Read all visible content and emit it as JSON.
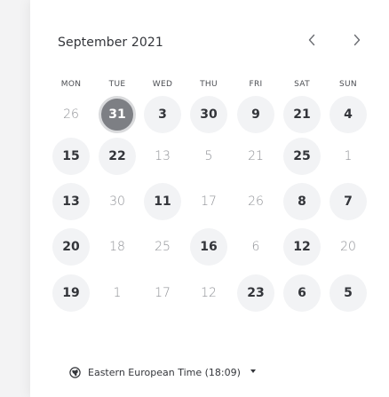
{
  "calendar": {
    "month_label": "September 2021",
    "nav": {
      "prev_icon": "chevron-left-icon",
      "next_icon": "chevron-right-icon"
    },
    "weekdays": [
      "MON",
      "TUE",
      "WED",
      "THU",
      "FRI",
      "SAT",
      "SUN"
    ],
    "weeks": [
      [
        {
          "label": "26",
          "state": "out"
        },
        {
          "label": "31",
          "state": "selected"
        },
        {
          "label": "3",
          "state": "in"
        },
        {
          "label": "30",
          "state": "in"
        },
        {
          "label": "9",
          "state": "in"
        },
        {
          "label": "21",
          "state": "in"
        },
        {
          "label": "4",
          "state": "in"
        }
      ],
      [
        {
          "label": "15",
          "state": "in"
        },
        {
          "label": "22",
          "state": "in"
        },
        {
          "label": "13",
          "state": "out"
        },
        {
          "label": "5",
          "state": "out"
        },
        {
          "label": "21",
          "state": "out"
        },
        {
          "label": "25",
          "state": "in"
        },
        {
          "label": "1",
          "state": "out"
        }
      ],
      [
        {
          "label": "13",
          "state": "in"
        },
        {
          "label": "30",
          "state": "out"
        },
        {
          "label": "11",
          "state": "in"
        },
        {
          "label": "17",
          "state": "out"
        },
        {
          "label": "26",
          "state": "out"
        },
        {
          "label": "8",
          "state": "in"
        },
        {
          "label": "7",
          "state": "in"
        }
      ],
      [
        {
          "label": "20",
          "state": "in"
        },
        {
          "label": "18",
          "state": "out"
        },
        {
          "label": "25",
          "state": "out"
        },
        {
          "label": "16",
          "state": "in"
        },
        {
          "label": "6",
          "state": "out"
        },
        {
          "label": "12",
          "state": "in"
        },
        {
          "label": "20",
          "state": "out"
        }
      ],
      [
        {
          "label": "19",
          "state": "in"
        },
        {
          "label": "1",
          "state": "out"
        },
        {
          "label": "17",
          "state": "out"
        },
        {
          "label": "12",
          "state": "out"
        },
        {
          "label": "23",
          "state": "in"
        },
        {
          "label": "6",
          "state": "in"
        },
        {
          "label": "5",
          "state": "in"
        }
      ]
    ],
    "colors": {
      "selected_fill": "#7d7f84",
      "selected_ring": "#dadbdd",
      "in_month_fill": "#f2f3f5",
      "text_dark": "#33353a",
      "text_muted": "#8f9196"
    }
  },
  "timezone": {
    "label": "Eastern European Time (18:09)",
    "icon": "globe-icon",
    "caret_icon": "caret-down-icon"
  }
}
